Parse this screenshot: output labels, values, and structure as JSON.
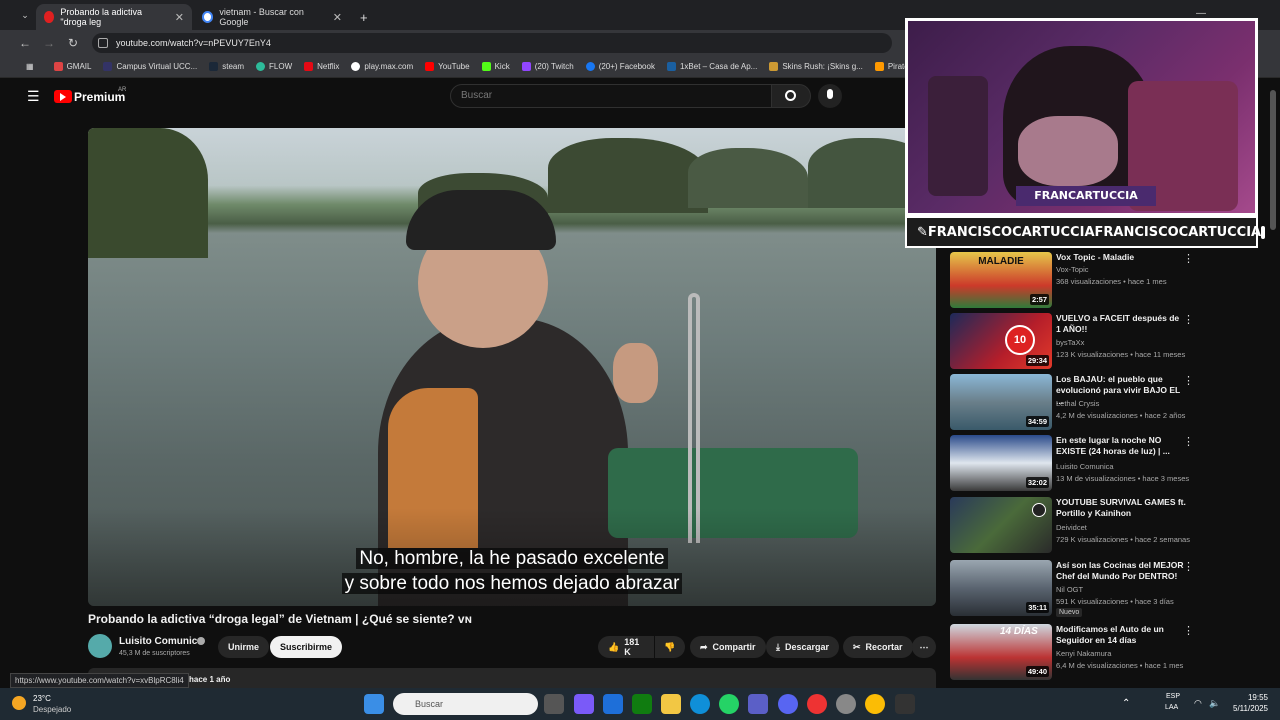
{
  "browser": {
    "tabs": [
      {
        "title": "Probando la adictiva \"droga leg",
        "active": true
      },
      {
        "title": "vietnam - Buscar con Google",
        "active": false
      }
    ],
    "url": "youtube.com/watch?v=nPEVUY7EnY4",
    "bookmarks": [
      "GMAIL",
      "Campus Virtual UCC...",
      "steam",
      "FLOW",
      "Netflix",
      "play.max.com",
      "YouTube",
      "Kick",
      "(20) Twitch",
      "(20+) Facebook",
      "1xBet – Casa de Ap...",
      "Skins Rush: ¡Skins g...",
      "Pirate"
    ]
  },
  "youtube": {
    "logo": "Premium",
    "region": "AR",
    "search_placeholder": "Buscar",
    "video": {
      "subtitle_line1": "No, hombre, la he pasado excelente",
      "subtitle_line2": "y sobre todo nos hemos dejado abrazar",
      "title": "Probando la adictiva “droga legal” de Vietnam | ¿Qué se siente? ᴠɴ",
      "channel": "Luisito Comunica",
      "subscribers": "45,3 M de suscriptores",
      "join_label": "Unirme",
      "subscribe_label": "Suscribirme",
      "likes": "181 K",
      "share_label": "Compartir",
      "download_label": "Descargar",
      "clip_label": "Recortar",
      "date_hint": "hace 1 año"
    },
    "recommendations": [
      {
        "title": "Vox Topic - Maladie",
        "channel": "Vox-Topic",
        "meta": "368 visualizaciones • hace 1 mes",
        "duration": "2:57",
        "thumb_text": "MALADIE",
        "new": false
      },
      {
        "title": "VUELVO a FACEIT después de 1 AÑO!!",
        "channel": "bysTaXx",
        "meta": "123 K visualizaciones • hace 11 meses",
        "duration": "29:34",
        "thumb_text": "",
        "new": false
      },
      {
        "title": "Los BAJAU: el pueblo que evolucionó para vivir BAJO EL ...",
        "channel": "Lethal Crysis",
        "meta": "4,2 M de visualizaciones • hace 2 años",
        "duration": "34:59",
        "thumb_text": "",
        "new": false
      },
      {
        "title": "En este lugar la noche NO EXISTE (24 horas de luz) | ...",
        "channel": "Luisito Comunica",
        "meta": "13 M de visualizaciones • hace 3 meses",
        "duration": "32:02",
        "thumb_text": "",
        "new": false
      },
      {
        "title": "YOUTUBE SURVIVAL GAMES ft. Portillo y Kainihon",
        "channel": "Deividcet",
        "meta": "729 K visualizaciones • hace 2 semanas",
        "duration": "",
        "thumb_text": "",
        "new": false
      },
      {
        "title": "Así son las Cocinas del MEJOR Chef del Mundo Por DENTRO!",
        "channel": "Nil OGT",
        "meta": "591 K visualizaciones • hace 3 días",
        "duration": "35:11",
        "thumb_text": "",
        "new": true
      },
      {
        "title": "Modificamos el Auto de un Seguidor en 14 días",
        "channel": "Kenyi Nakamura",
        "meta": "6,4 M de visualizaciones • hace 1 mes",
        "duration": "49:40",
        "thumb_text": "14 DÍAS",
        "new": false
      }
    ],
    "new_label": "Nuevo"
  },
  "stream": {
    "name_badge": "FRANCARTUCCIA",
    "handle_left": "FRANCISCOCARTUCCIA",
    "handle_right": "FRANCISCOCARTUCCIA"
  },
  "status_url": "https://www.youtube.com/watch?v=xvBlpRC8li4",
  "taskbar": {
    "weather_temp": "23°C",
    "weather_desc": "Despejado",
    "search_placeholder": "Buscar",
    "lang": "ESP",
    "lang_sub": "LAA",
    "time": "19:55",
    "date": "5/11/2025"
  }
}
